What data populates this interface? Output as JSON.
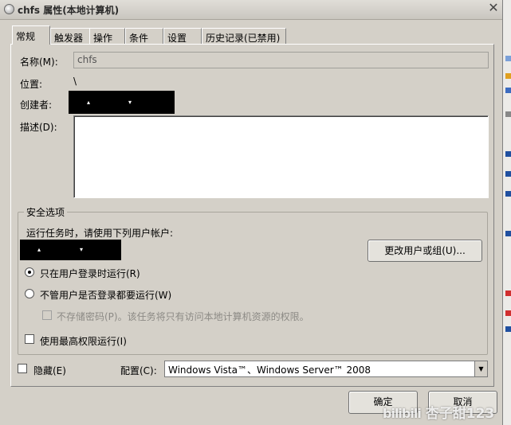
{
  "window": {
    "title": "chfs 属性(本地计算机)",
    "close": "✕"
  },
  "tabs": [
    {
      "label": "常规",
      "active": true
    },
    {
      "label": "触发器"
    },
    {
      "label": "操作"
    },
    {
      "label": "条件"
    },
    {
      "label": "设置"
    },
    {
      "label": "历史记录(已禁用)"
    }
  ],
  "general": {
    "name_label": "名称(M):",
    "name_value": "chfs",
    "location_label": "位置:",
    "location_value": "\\",
    "author_label": "创建者:",
    "description_label": "描述(D):"
  },
  "security": {
    "group_title": "安全选项",
    "run_as_text": "运行任务时，请使用下列用户帐户:",
    "change_user_button": "更改用户或组(U)...",
    "option_logged_on": "只在用户登录时运行(R)",
    "option_logged_on_selected": true,
    "option_whether": "不管用户是否登录都要运行(W)",
    "option_whether_selected": false,
    "no_store_password": "不存储密码(P)。该任务将只有访问本地计算机资源的权限。",
    "no_store_password_checked": false,
    "highest_privileges": "使用最高权限运行(I)",
    "highest_privileges_checked": false
  },
  "footer": {
    "hidden_label": "隐藏(E)",
    "hidden_checked": false,
    "config_label": "配置(C):",
    "config_value": "Windows Vista™、Windows Server™ 2008",
    "ok_button": "确定",
    "cancel_button": "取消"
  },
  "watermark": {
    "logo": "bilibili",
    "text": "杏子甜123"
  }
}
